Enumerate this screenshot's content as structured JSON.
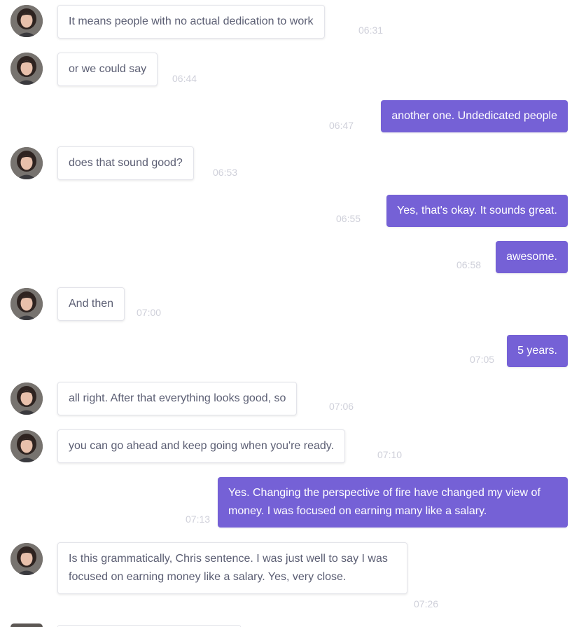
{
  "colors": {
    "outgoing_bubble": "#7561d6",
    "incoming_bubble": "#ffffff",
    "incoming_text": "#5b5e73",
    "timestamp": "#cfd0da"
  },
  "contact": {
    "avatar_icon": "person-avatar-icon"
  },
  "messages": [
    {
      "direction": "in",
      "text": "It means people with no actual dedication to work",
      "time": "06:31"
    },
    {
      "direction": "in",
      "text": "or we could say",
      "time": "06:44"
    },
    {
      "direction": "out",
      "text": "another one. Undedicated people",
      "time": "06:47"
    },
    {
      "direction": "in",
      "text": "does that sound good?",
      "time": "06:53"
    },
    {
      "direction": "out",
      "text": "Yes, that's okay. It sounds great.",
      "time": "06:55"
    },
    {
      "direction": "out",
      "text": "awesome.",
      "time": "06:58"
    },
    {
      "direction": "in",
      "text": "And then",
      "time": "07:00"
    },
    {
      "direction": "out",
      "text": "5 years.",
      "time": "07:05"
    },
    {
      "direction": "in",
      "text": "all right. After that everything looks good, so",
      "time": "07:06"
    },
    {
      "direction": "in",
      "text": "you can go ahead and keep going when you're ready.",
      "time": "07:10"
    },
    {
      "direction": "out",
      "text": "Yes. Changing the perspective of fire have changed my view of money. I was focused on earning many like a salary.",
      "time": "07:13"
    },
    {
      "direction": "in",
      "text": "Is this grammatically, Chris sentence. I was just well to say I was focused on earning money like a salary. Yes, very close.",
      "time": "07:26"
    }
  ]
}
